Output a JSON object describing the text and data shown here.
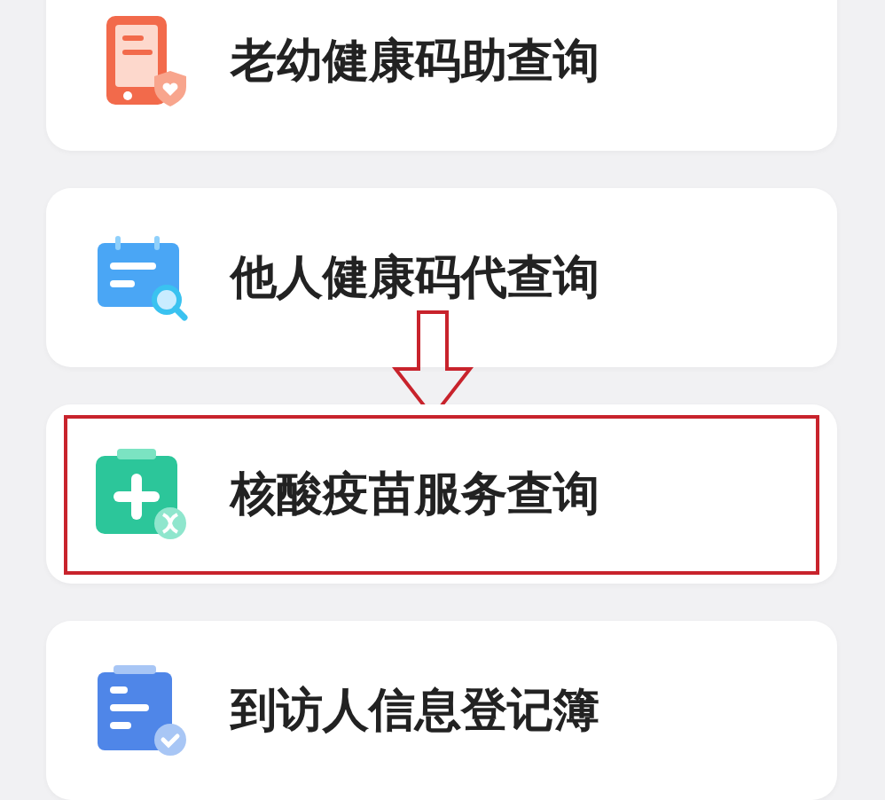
{
  "services": [
    {
      "label": "老幼健康码助查询",
      "kind": "phone",
      "highlighted": false
    },
    {
      "label": "他人健康码代查询",
      "kind": "calendar",
      "highlighted": false
    },
    {
      "label": "核酸疫苗服务查询",
      "kind": "medical",
      "highlighted": true
    },
    {
      "label": "到访人信息登记簿",
      "kind": "register",
      "highlighted": false
    }
  ]
}
